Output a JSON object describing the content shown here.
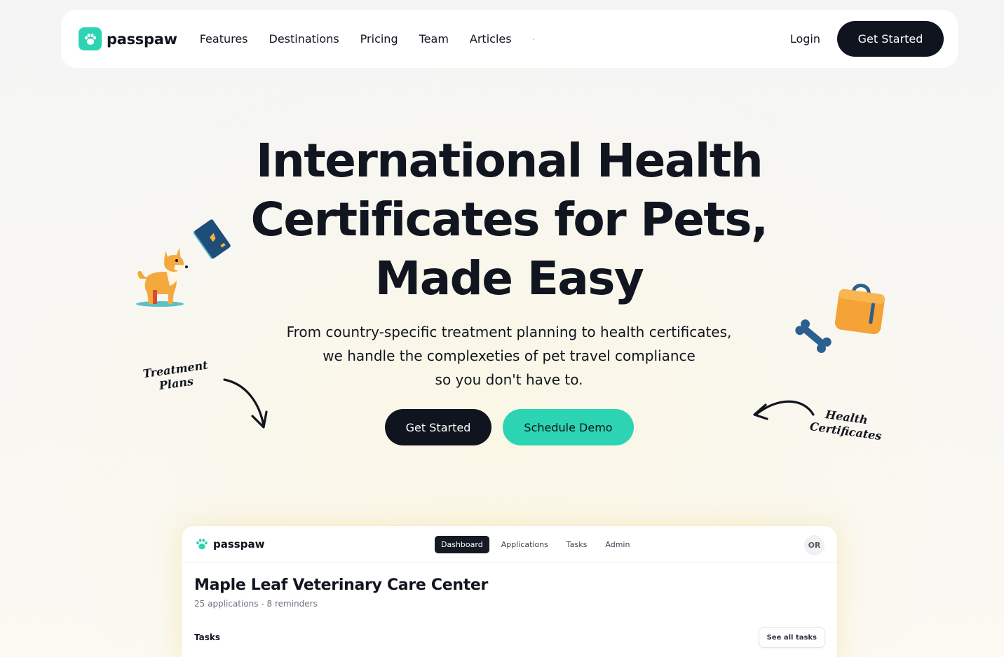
{
  "nav": {
    "logo_text": "passpaw",
    "links": [
      "Features",
      "Destinations",
      "Pricing",
      "Team",
      "Articles"
    ],
    "login_label": "Login",
    "cta_label": "Get Started"
  },
  "hero": {
    "title_lines": [
      "International Health",
      "Certificates for Pets,",
      "Made Easy"
    ],
    "subtitle_lines": [
      "From country-specific treatment planning to health certificates,",
      "we handle the complexeties of pet travel compliance",
      "so you don't have to."
    ],
    "primary_cta": "Get Started",
    "secondary_cta": "Schedule Demo"
  },
  "annotations": {
    "left_lines": [
      "Treatment",
      "Plans"
    ],
    "right_lines": [
      "Health",
      "Certificates"
    ]
  },
  "preview": {
    "logo_text": "passpaw",
    "tabs": [
      "Dashboard",
      "Applications",
      "Tasks",
      "Admin"
    ],
    "active_tab": "Dashboard",
    "avatar_initials": "OR",
    "clinic_name": "Maple Leaf Veterinary Care Center",
    "clinic_meta": "25 applications - 8 reminders",
    "tasks_heading": "Tasks",
    "see_all_label": "See all tasks"
  },
  "colors": {
    "brand_teal": "#2dd4b3",
    "dark": "#0f141e",
    "background": "#f5f5f5"
  },
  "icons": [
    "paw-icon",
    "dog-illustration",
    "passport-illustration",
    "bone-illustration",
    "suitcase-illustration",
    "curved-arrow-icon"
  ]
}
